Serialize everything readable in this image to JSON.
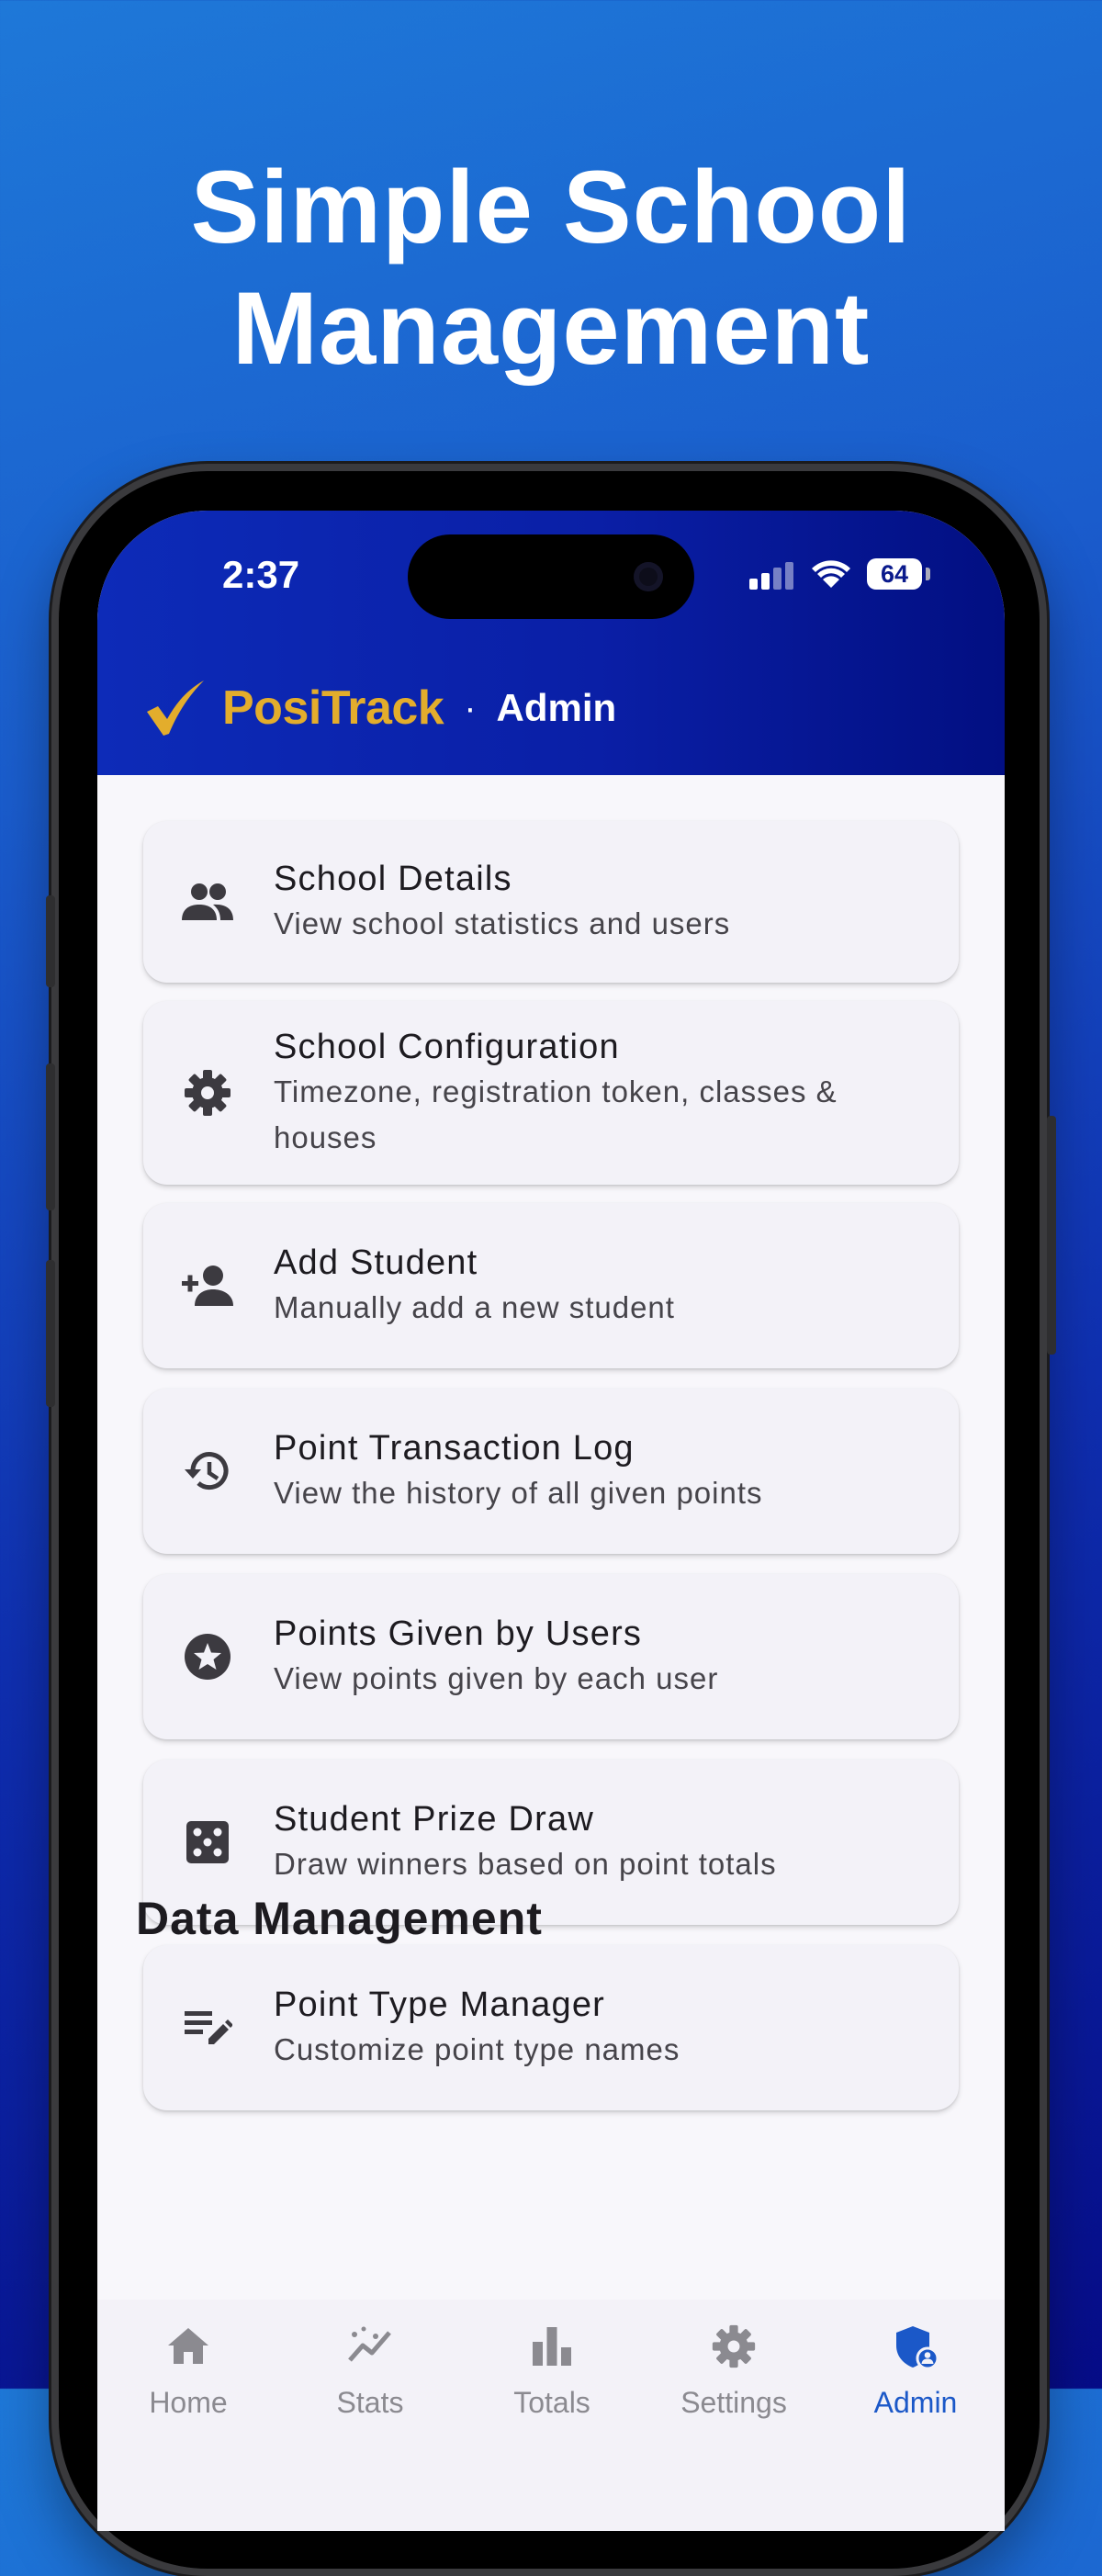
{
  "headline": {
    "line1": "Simple School",
    "line2": "Management"
  },
  "status_bar": {
    "time": "2:37",
    "battery": "64"
  },
  "app_bar": {
    "brand": "PosiTrack",
    "separator": "·",
    "section": "Admin"
  },
  "admin_items": [
    {
      "title": "School Details",
      "subtitle": "View school statistics and users",
      "icon": "group-icon"
    },
    {
      "title": "School Configuration",
      "subtitle": "Timezone, registration token, classes &",
      "subtitle2": "houses",
      "icon": "gear-icon"
    },
    {
      "title": "Add Student",
      "subtitle": "Manually add a new student",
      "icon": "person-add-icon"
    },
    {
      "title": "Point Transaction Log",
      "subtitle": "View the history of all given points",
      "icon": "history-icon"
    },
    {
      "title": "Points Given by Users",
      "subtitle": "View points given by each user",
      "icon": "star-circle-icon"
    },
    {
      "title": "Student Prize Draw",
      "subtitle": "Draw winners based on point totals",
      "icon": "dice-icon"
    },
    {
      "title": "Point Type Manager",
      "subtitle": "Customize point type names",
      "icon": "edit-list-icon"
    }
  ],
  "data_management": {
    "title": "Data Management"
  },
  "bottom_nav": [
    {
      "label": "Home",
      "icon": "home-icon"
    },
    {
      "label": "Stats",
      "icon": "stats-icon"
    },
    {
      "label": "Totals",
      "icon": "bar-chart-icon"
    },
    {
      "label": "Settings",
      "icon": "settings-icon"
    },
    {
      "label": "Admin",
      "icon": "admin-shield-icon",
      "active": true
    }
  ],
  "colors": {
    "brand_gold": "#e3ad2c",
    "app_bar_blue": "#0a1fa6",
    "active_nav": "#1b58c8"
  }
}
